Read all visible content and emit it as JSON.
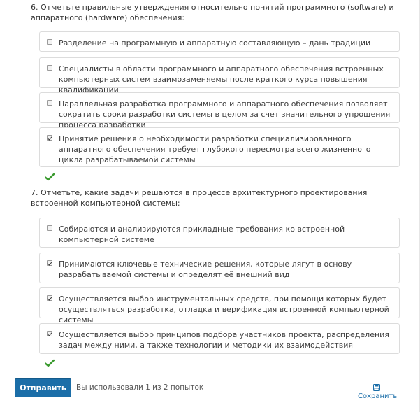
{
  "q6": {
    "prompt": "6. Отметьте правильные утверждения относительно понятий программного (software) и аппаратного (hardware) обеспечения:",
    "options": [
      {
        "label": "Разделение на программную и аппаратную составляющую – дань традиции",
        "checked": false
      },
      {
        "label": "Специалисты в области программного и аппаратного обеспечения встроенных компьютерных систем взаимозаменяемы после краткого курса повышения квалификации",
        "checked": false
      },
      {
        "label": "Параллельная разработка программного и аппаратного обеспечения позволяет сократить сроки разработки системы в целом за счет значительного упрощения процесса разработки",
        "checked": false
      },
      {
        "label": "Принятие решения о необходимости разработки специализированного аппаратного обеспечения требует глубокого пересмотра всего жизненного цикла разрабатываемой системы",
        "checked": true
      }
    ]
  },
  "q7": {
    "prompt": "7. Отметьте, какие задачи решаются в процессе архитектурного проектирования встроенной компьютерной системы:",
    "options": [
      {
        "label": "Собираются и анализируются прикладные требования ко встроенной компьютерной системе",
        "checked": false
      },
      {
        "label": "Принимаются ключевые технические решения, которые лягут в основу разрабатываемой системы и определят её внешний вид",
        "checked": true
      },
      {
        "label": "Осуществляется выбор инструментальных средств, при помощи которых будет осуществляться разработка, отладка и верификация встроенной компьютерной системы",
        "checked": true
      },
      {
        "label": "Осуществляется выбор принципов подбора участников проекта, распределения задач между ними, а также технологии и методики их взаимодействия",
        "checked": true
      }
    ]
  },
  "footer": {
    "submit_label": "Отправить",
    "attempts_text": "Вы использовали 1 из 2 попыток",
    "save_label": "Сохранить"
  },
  "colors": {
    "accent": "#1b6ea8",
    "correct": "#3a9a2e",
    "border": "#dcdcdc"
  },
  "icons": {
    "correct": "checkmark-icon",
    "save": "save-icon"
  }
}
